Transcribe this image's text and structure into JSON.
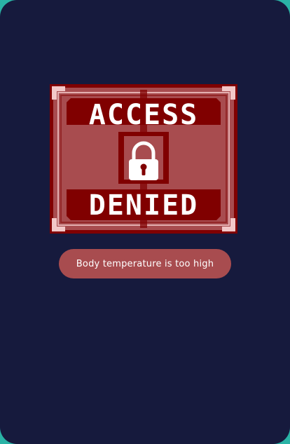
{
  "badge": {
    "line1": "ACCESS",
    "line2": "DENIED",
    "icon": "lock-icon"
  },
  "message": {
    "text": "Body temperature is too high"
  },
  "colors": {
    "background": "#161a3d",
    "outer_frame": "#2ab3a6",
    "badge_fill": "#a84c4f",
    "badge_dark": "#800000",
    "badge_light": "#f2c8c8",
    "pill": "#a84c4f"
  }
}
